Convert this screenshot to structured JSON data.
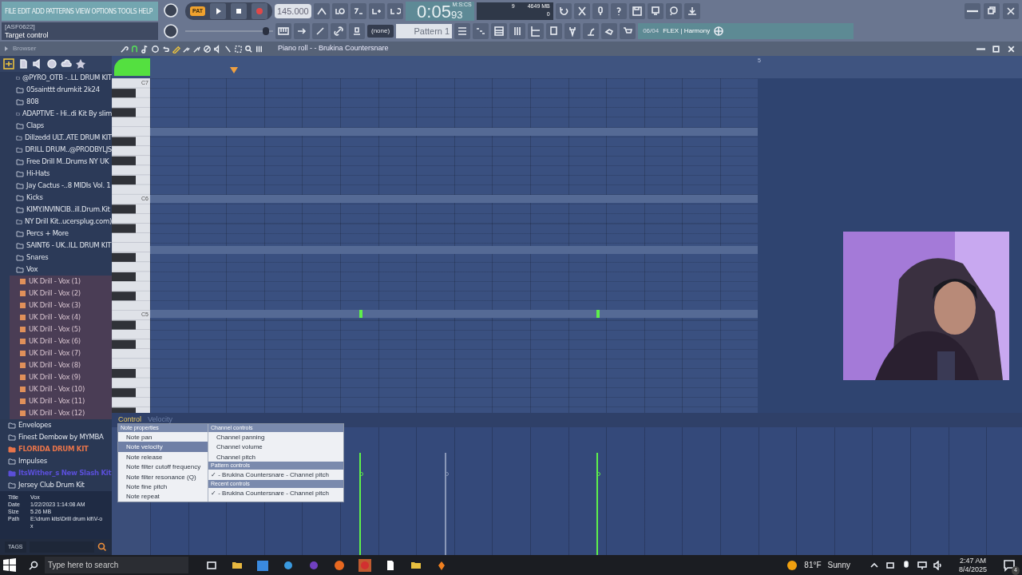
{
  "menu": [
    "FILE",
    "EDIT",
    "ADD",
    "PATTERNS",
    "VIEW",
    "OPTIONS",
    "TOOLS",
    "HELP"
  ],
  "hint": {
    "code": "[ASF0622]",
    "text": "Target control"
  },
  "transport": {
    "mode": "PAT",
    "tempo": "145.000",
    "time": "0:05",
    "time_fraction": "93",
    "time_label": "M:S:CS"
  },
  "monitor": {
    "voices": "9",
    "memory": "4649 MB",
    "value": "0"
  },
  "master_slider": {
    "level": 0.95
  },
  "pattern": {
    "selector": "(none)",
    "name": "Pattern 1"
  },
  "news": {
    "date": "06/04",
    "text": "FLEX | Harmony"
  },
  "browser": {
    "title": "Browser",
    "items": [
      {
        "label": "@PYRO_OTB -..LL DRUM KIT",
        "kind": "folder"
      },
      {
        "label": "05sainttt drumkit 2k24",
        "kind": "folder"
      },
      {
        "label": "808",
        "kind": "folder"
      },
      {
        "label": "ADAPTIVE - Hi..di Kit By slim",
        "kind": "folder"
      },
      {
        "label": "Claps",
        "kind": "folder"
      },
      {
        "label": "Dillzedd ULT..ATE DRUM KIT",
        "kind": "folder"
      },
      {
        "label": "DRILL DRUM..@PRODBYLJS",
        "kind": "folder"
      },
      {
        "label": "Free Drill M..Drums NY  UK",
        "kind": "folder"
      },
      {
        "label": "Hi-Hats",
        "kind": "folder"
      },
      {
        "label": "Jay Cactus -..8 MIDIs Vol. 1",
        "kind": "folder"
      },
      {
        "label": "Kicks",
        "kind": "folder"
      },
      {
        "label": "KIMY.INVINCIB..ill.Drum.Kit",
        "kind": "folder"
      },
      {
        "label": "NY Drill Kit..ucersplug.com)",
        "kind": "folder"
      },
      {
        "label": "Percs + More",
        "kind": "folder"
      },
      {
        "label": "SAINT6 - UK..ILL DRUM KIT",
        "kind": "folder"
      },
      {
        "label": "Snares",
        "kind": "folder"
      },
      {
        "label": "Vox",
        "kind": "folder",
        "expanded": true,
        "children": [
          {
            "label": "UK Drill - Vox (1)",
            "kind": "audio"
          },
          {
            "label": "UK Drill - Vox (2)",
            "kind": "audio"
          },
          {
            "label": "UK Drill - Vox (3)",
            "kind": "audio"
          },
          {
            "label": "UK Drill - Vox (4)",
            "kind": "audio"
          },
          {
            "label": "UK Drill - Vox (5)",
            "kind": "audio"
          },
          {
            "label": "UK Drill - Vox (6)",
            "kind": "audio"
          },
          {
            "label": "UK Drill - Vox (7)",
            "kind": "audio"
          },
          {
            "label": "UK Drill - Vox (8)",
            "kind": "audio"
          },
          {
            "label": "UK Drill - Vox (9)",
            "kind": "audio"
          },
          {
            "label": "UK Drill - Vox (10)",
            "kind": "audio"
          },
          {
            "label": "UK Drill - Vox (11)",
            "kind": "audio"
          },
          {
            "label": "UK Drill - Vox (12)",
            "kind": "audio"
          }
        ]
      }
    ],
    "items_below": [
      {
        "label": "Envelopes",
        "kind": "folder"
      },
      {
        "label": "Finest Dembow by MYMBA",
        "kind": "folder"
      },
      {
        "label": "FLORIDA DRUM KIT",
        "kind": "folder",
        "color": "#e8744a"
      },
      {
        "label": "Impulses",
        "kind": "folder"
      },
      {
        "label": "ItsWither_s New Slash Kit",
        "kind": "folder",
        "color": "#5a4fd8"
      },
      {
        "label": "Jersey Club Drum Kit",
        "kind": "folder"
      }
    ],
    "info": [
      {
        "label": "Title",
        "value": "Vox"
      },
      {
        "label": "Date",
        "value": "1/22/2023 1:14:08 AM"
      },
      {
        "label": "Size",
        "value": "5.26 MB"
      },
      {
        "label": "Path",
        "value": "E:\\drum kits\\Drill drum kit\\V-ox"
      }
    ],
    "tags_label": "TAGS"
  },
  "piano_roll": {
    "title": "Piano roll - - Brukina Countersnare",
    "key_labels": [
      "C7",
      "C6",
      "C5"
    ],
    "bar_label": "5",
    "event_editor": {
      "target": "Control",
      "parameter": "Velocity",
      "bars": [
        {
          "level": 0.8,
          "kind": "note"
        },
        {
          "level": 0.8,
          "kind": "ghost"
        },
        {
          "level": 0.8,
          "kind": "note"
        }
      ]
    }
  },
  "context_menu": {
    "check_mark": "✓",
    "columns": [
      [
        {
          "heading": "Note properties",
          "items": [
            {
              "label": "Note pan",
              "selected": false,
              "checked": false
            },
            {
              "label": "Note velocity",
              "selected": true,
              "checked": false
            },
            {
              "label": "Note release",
              "selected": false,
              "checked": false
            },
            {
              "label": "Note filter cutoff frequency",
              "selected": false,
              "checked": false
            },
            {
              "label": "Note filter resonance (Q)",
              "selected": false,
              "checked": false
            },
            {
              "label": "Note fine pitch",
              "selected": false,
              "checked": false
            },
            {
              "label": "Note repeat",
              "selected": false,
              "checked": false
            }
          ]
        }
      ],
      [
        {
          "heading": "Channel controls",
          "items": [
            {
              "label": "Channel panning",
              "selected": false,
              "checked": false
            },
            {
              "label": "Channel volume",
              "selected": false,
              "checked": false
            },
            {
              "label": "Channel pitch",
              "selected": false,
              "checked": false
            }
          ]
        },
        {
          "heading": "Pattern controls",
          "items": [
            {
              "label": "- Brukina Countersnare - Channel pitch",
              "selected": false,
              "checked": true
            }
          ]
        },
        {
          "heading": "Recent controls",
          "items": [
            {
              "label": "- Brukina Countersnare - Channel pitch",
              "selected": false,
              "checked": true
            }
          ]
        }
      ]
    ]
  },
  "taskbar": {
    "search_placeholder": "Type here to search",
    "temperature": "81°F",
    "weather": "Sunny",
    "time": "2:47 AM",
    "date": "8/4/2025",
    "notifications": "4"
  }
}
